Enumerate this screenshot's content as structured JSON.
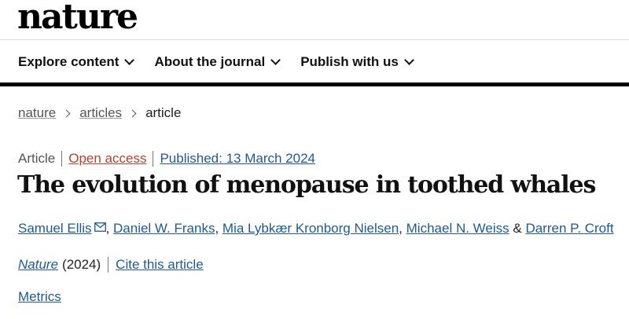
{
  "header": {
    "logo": "nature"
  },
  "nav": {
    "items": [
      {
        "label": "Explore content"
      },
      {
        "label": "About the journal"
      },
      {
        "label": "Publish with us"
      }
    ]
  },
  "breadcrumb": {
    "items": [
      "nature",
      "articles",
      "article"
    ]
  },
  "meta": {
    "type": "Article",
    "access": "Open access",
    "published": "Published: 13 March 2024"
  },
  "article": {
    "title": "The evolution of menopause in toothed whales"
  },
  "authors": {
    "list": [
      "Samuel Ellis",
      "Daniel W. Franks",
      "Mia Lybkær Kronborg Nielsen",
      "Michael N. Weiss",
      "Darren P. Croft"
    ],
    "comma": ",",
    "ampersand": "&"
  },
  "citation": {
    "journal": "Nature",
    "year": "(2024)",
    "cite_label": "Cite this article"
  },
  "metrics": {
    "label": "Metrics"
  },
  "colors": {
    "link": "#1f5a8c",
    "open_access": "#b1442a",
    "text": "#222222"
  },
  "icons": {
    "mail": "mail-icon",
    "chevron": "chevron-down-icon",
    "breadcrumb_sep": "chevron-right-icon"
  }
}
